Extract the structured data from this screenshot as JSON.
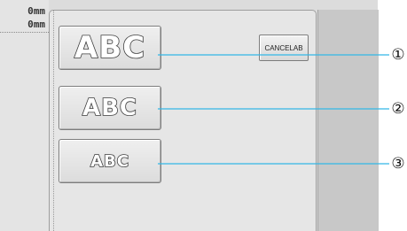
{
  "readout": {
    "x_value": "0mm",
    "y_value": "0mm"
  },
  "size_buttons": [
    {
      "label": "ABC",
      "size": "large"
    },
    {
      "label": "ABC",
      "size": "medium"
    },
    {
      "label": "ABC",
      "size": "small"
    }
  ],
  "cancel_label": "CANCELAB",
  "callouts": [
    "①",
    "②",
    "③"
  ],
  "colors": {
    "callout_line": "#33b7e6"
  }
}
